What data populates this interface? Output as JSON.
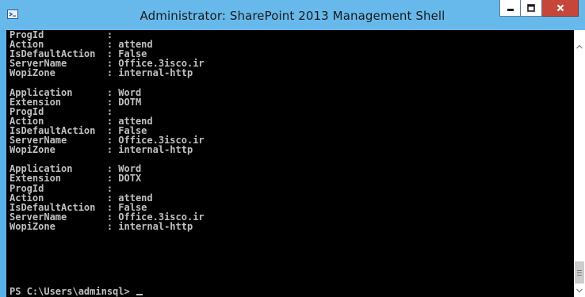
{
  "window": {
    "title": "Administrator: SharePoint 2013 Management Shell"
  },
  "icons": {
    "app": "powershell-icon",
    "minimize": "minimize-icon",
    "maximize": "maximize-icon",
    "close": "close-icon",
    "scroll_up": "chevron-up-icon",
    "scroll_down": "chevron-down-icon"
  },
  "console": {
    "lines": [
      "ProgId           :",
      "Action           : attend",
      "IsDefaultAction  : False",
      "ServerName       : Office.3isco.ir",
      "WopiZone         : internal-http",
      "",
      "Application      : Word",
      "Extension        : DOTM",
      "ProgId           :",
      "Action           : attend",
      "IsDefaultAction  : False",
      "ServerName       : Office.3isco.ir",
      "WopiZone         : internal-http",
      "",
      "Application      : Word",
      "Extension        : DOTX",
      "ProgId           :",
      "Action           : attend",
      "IsDefaultAction  : False",
      "ServerName       : Office.3isco.ir",
      "WopiZone         : internal-http"
    ],
    "prompt": "PS C:\\Users\\adminsql> "
  },
  "colors": {
    "titlebar": "#67b9ec",
    "console_bg": "#000000",
    "console_fg": "#c0c0c0",
    "close_button": "#c7463a"
  }
}
